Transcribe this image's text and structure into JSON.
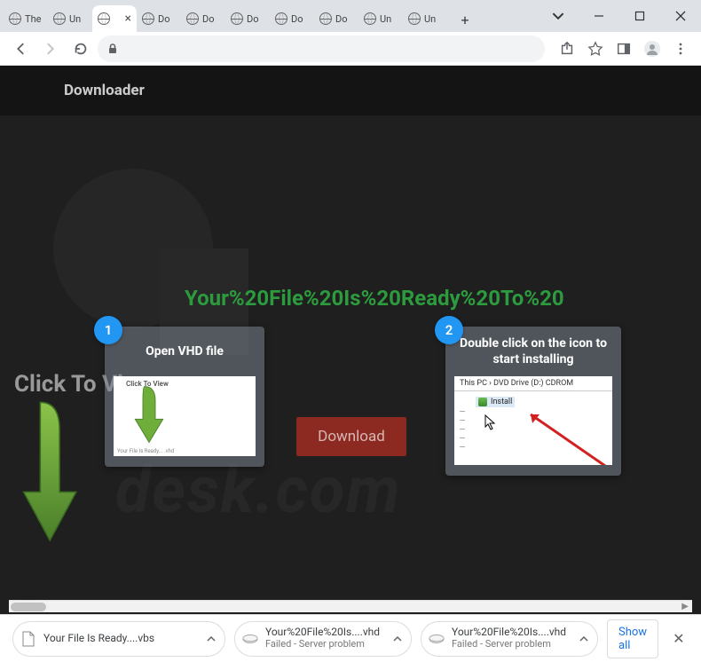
{
  "window": {
    "tabs": [
      {
        "label": "The"
      },
      {
        "label": "Un"
      },
      {
        "label": "",
        "active": true
      },
      {
        "label": "Do"
      },
      {
        "label": "Do"
      },
      {
        "label": "Do"
      },
      {
        "label": "Do"
      },
      {
        "label": "Do"
      },
      {
        "label": "Un"
      },
      {
        "label": "Un"
      }
    ]
  },
  "page": {
    "brand": "Downloader",
    "headline": "Your%20File%20Is%20Ready%20To%20",
    "click_to_view": "Click To View",
    "download_label": "Download",
    "step1": {
      "num": "1",
      "title": "Open VHD file",
      "thumb_caption": "Click To View"
    },
    "step2": {
      "num": "2",
      "title": "Double click on the icon to start installing",
      "explorer_path": "This PC  ›  DVD Drive (D:) CDROM",
      "install_label": "Install"
    }
  },
  "downloads": {
    "items": [
      {
        "name": "Your File Is Ready....vbs",
        "status": ""
      },
      {
        "name": "Your%20File%20Is....vhd",
        "status": "Failed - Server problem"
      },
      {
        "name": "Your%20File%20Is....vhd",
        "status": "Failed - Server problem"
      }
    ],
    "show_all": "Show all"
  }
}
